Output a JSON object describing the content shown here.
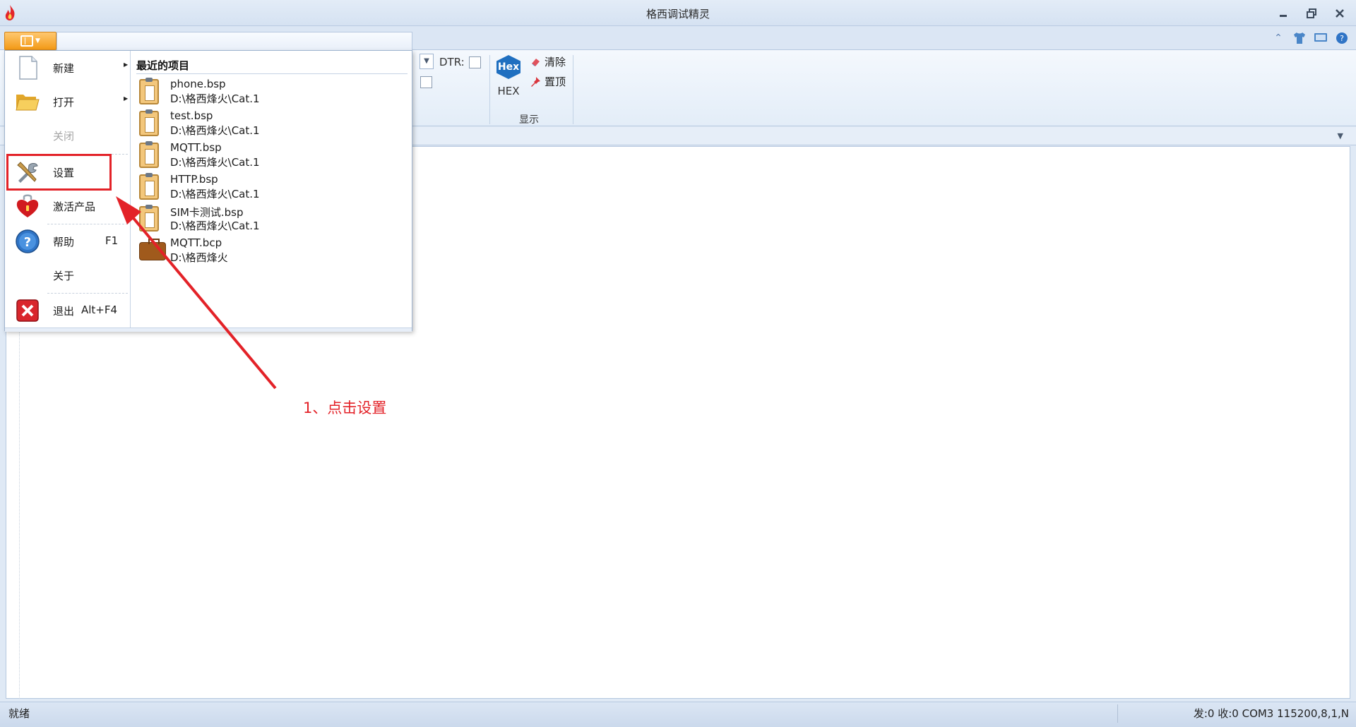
{
  "window": {
    "title": "格西调试精灵"
  },
  "ribbon": {
    "dtr_label": "DTR:",
    "hex_icon_text": "Hex",
    "hex_label": "HEX",
    "clear_label": "清除",
    "pin_label": "置顶",
    "group_display": "显示"
  },
  "app_menu": {
    "items": [
      {
        "label": "新建",
        "shortcut": "",
        "icon": "new-file-icon"
      },
      {
        "label": "打开",
        "shortcut": "",
        "icon": "folder-open-icon"
      },
      {
        "label": "关闭",
        "shortcut": "",
        "icon": ""
      },
      {
        "label": "设置",
        "shortcut": "",
        "icon": "tools-icon"
      },
      {
        "label": "激活产品",
        "shortcut": "",
        "icon": "heart-lock-icon"
      },
      {
        "label": "帮助",
        "shortcut": "F1",
        "icon": "help-icon"
      },
      {
        "label": "关于",
        "shortcut": "",
        "icon": ""
      },
      {
        "label": "退出",
        "shortcut": "Alt+F4",
        "icon": "exit-icon"
      }
    ],
    "recent_title": "最近的项目",
    "recent": [
      {
        "name": "phone.bsp",
        "path": "D:\\格西烽火\\Cat.1"
      },
      {
        "name": "test.bsp",
        "path": "D:\\格西烽火\\Cat.1"
      },
      {
        "name": "MQTT.bsp",
        "path": "D:\\格西烽火\\Cat.1"
      },
      {
        "name": "HTTP.bsp",
        "path": "D:\\格西烽火\\Cat.1"
      },
      {
        "name": "SIM卡测试.bsp",
        "path": "D:\\格西烽火\\Cat.1"
      },
      {
        "name": "MQTT.bcp",
        "path": "D:\\格西烽火"
      }
    ]
  },
  "annotation": "1、点击设置",
  "status": {
    "left": "就绪",
    "right": "发:0 收:0 COM3 115200,8,1,N"
  },
  "colors": {
    "highlight": "#e32228",
    "menu_button": "#f39a17"
  }
}
